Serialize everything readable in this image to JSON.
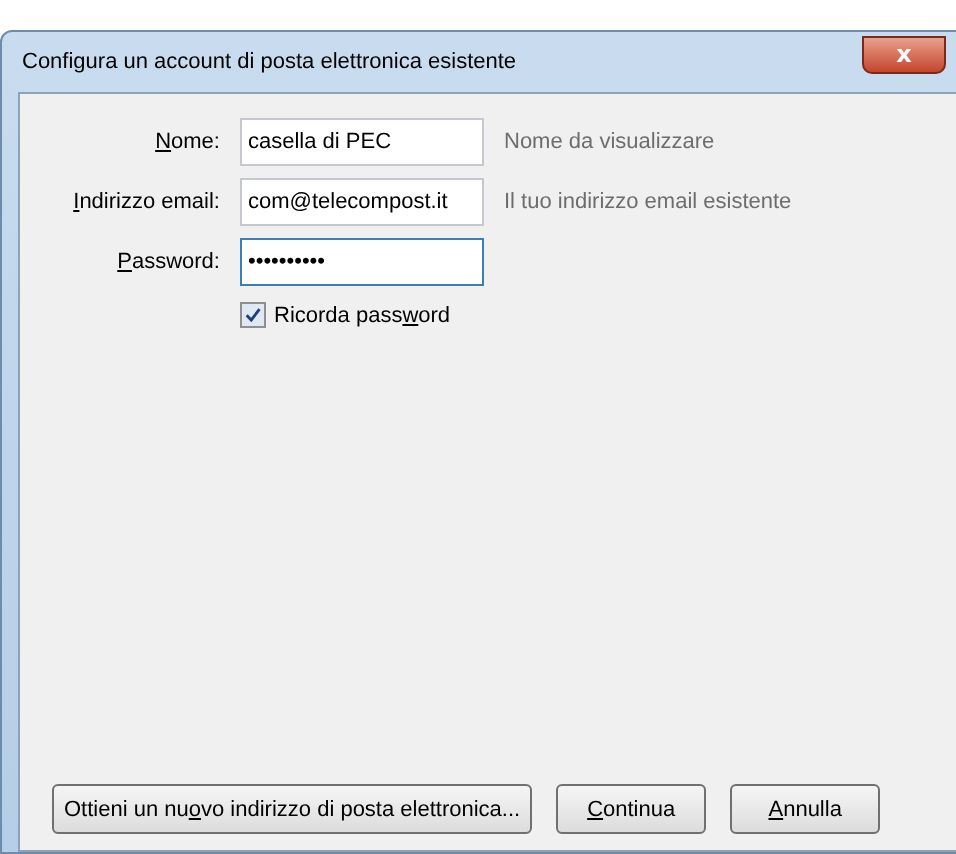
{
  "window": {
    "title": "Configura un account di posta elettronica esistente",
    "close_symbol": "x"
  },
  "fields": [
    {
      "label_key": "N",
      "label_post": "ome:",
      "value": "casella di PEC",
      "focused": false,
      "hint": "Nome da visualizzare"
    },
    {
      "label_key": "I",
      "label_post": "ndirizzo email:",
      "value": "com@telecompost.it",
      "focused": false,
      "hint": "Il tuo indirizzo email esistente"
    },
    {
      "label_key": "P",
      "label_post": "assword:",
      "value": "••••••••••",
      "focused": true
    }
  ],
  "remember": {
    "label_pre": "Ricorda pass",
    "label_key": "w",
    "label_post": "ord",
    "checked": true
  },
  "buttons": [
    {
      "label_pre": "Ottieni un nu",
      "label_key": "o",
      "label_post": "vo indirizzo di posta elettronica..."
    },
    {
      "label_key": "C",
      "label_post": "ontinua"
    },
    {
      "label_key": "A",
      "label_post": "nnulla"
    }
  ]
}
